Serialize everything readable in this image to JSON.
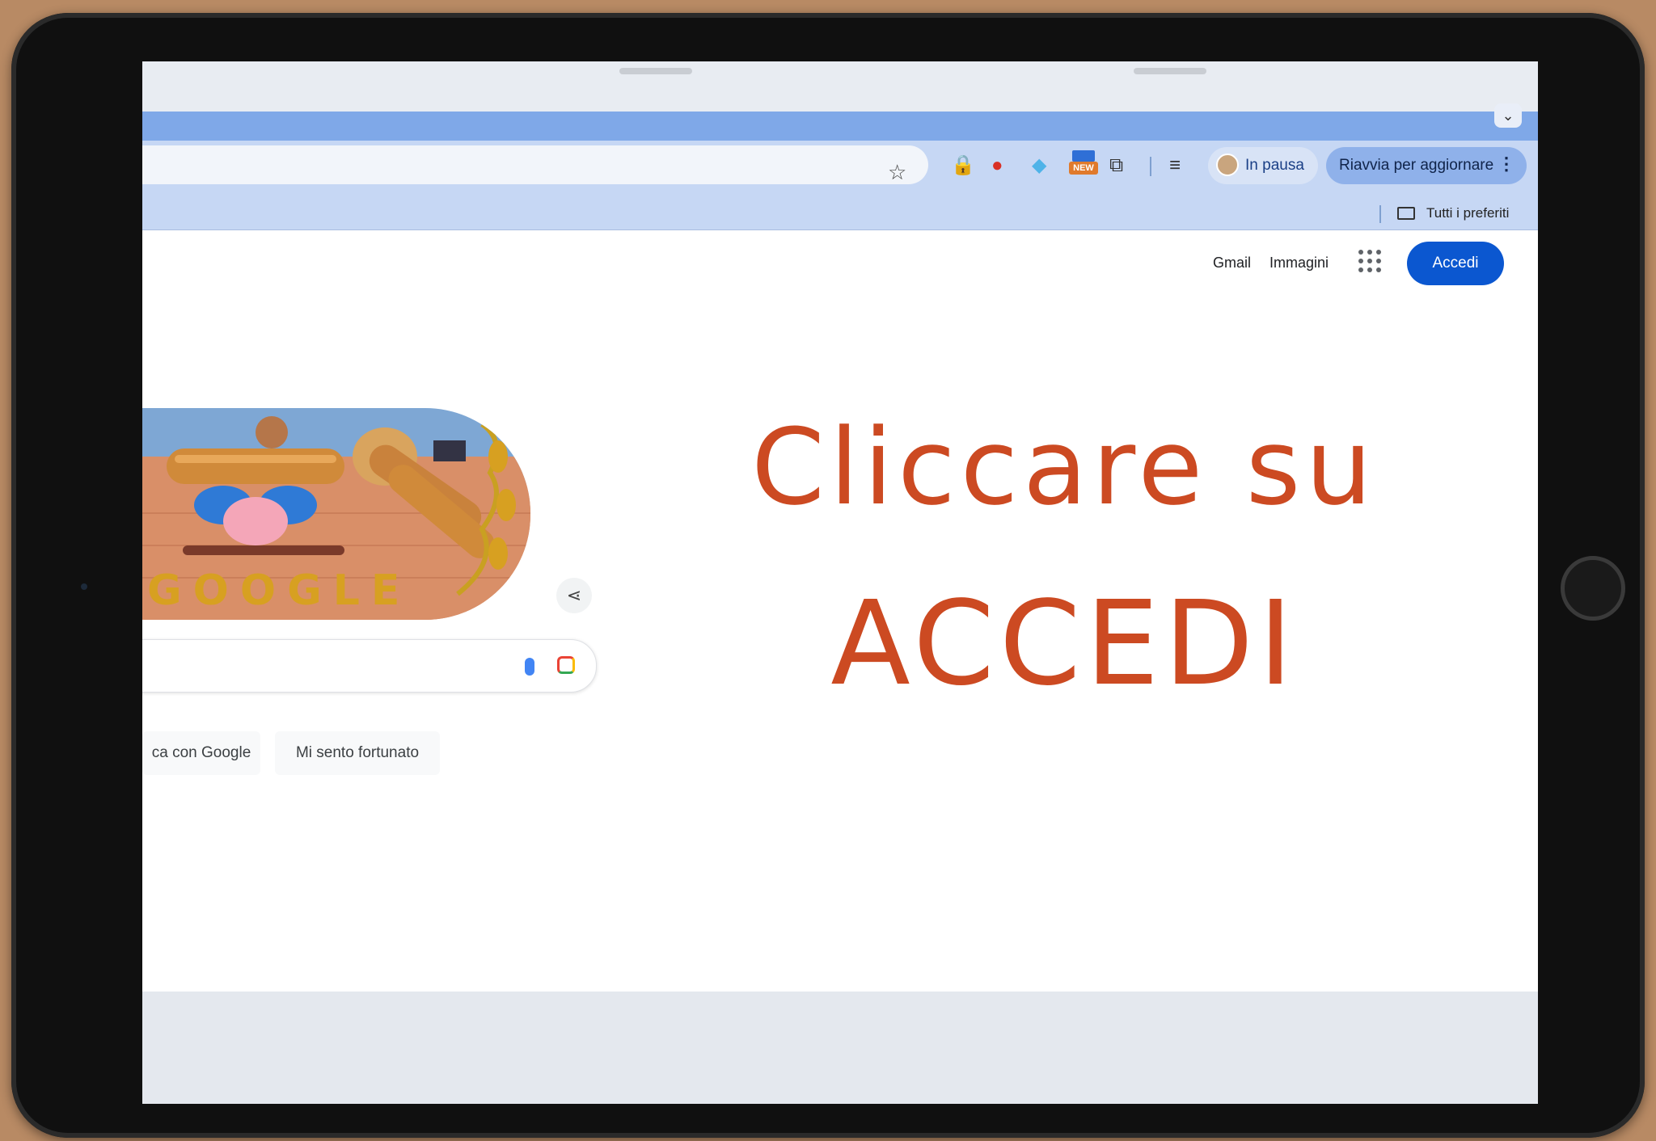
{
  "browser": {
    "profile_label": "In pausa",
    "update_label": "Riavvia per aggiornare",
    "extensions": [
      "lock-icon",
      "tomato-icon",
      "diamond-icon",
      "new-badge-icon",
      "puzzle-icon",
      "playlist-icon"
    ],
    "new_badge_label": "NEW",
    "bookmarks_label": "Tutti i preferiti"
  },
  "page": {
    "links": [
      "Gmail",
      "Immagini"
    ],
    "signin_label": "Accedi",
    "doodle_word": "GOOGLE",
    "search_button_label": "ca con Google",
    "lucky_button_label": "Mi sento fortunato"
  },
  "caption": {
    "line1": "Cliccare su",
    "line2": "ACCEDI"
  },
  "colors": {
    "accent": "#0b57d0",
    "caption": "#cc4a22",
    "tab_bar": "#7fa8e8",
    "toolbar": "#c6d7f4"
  }
}
